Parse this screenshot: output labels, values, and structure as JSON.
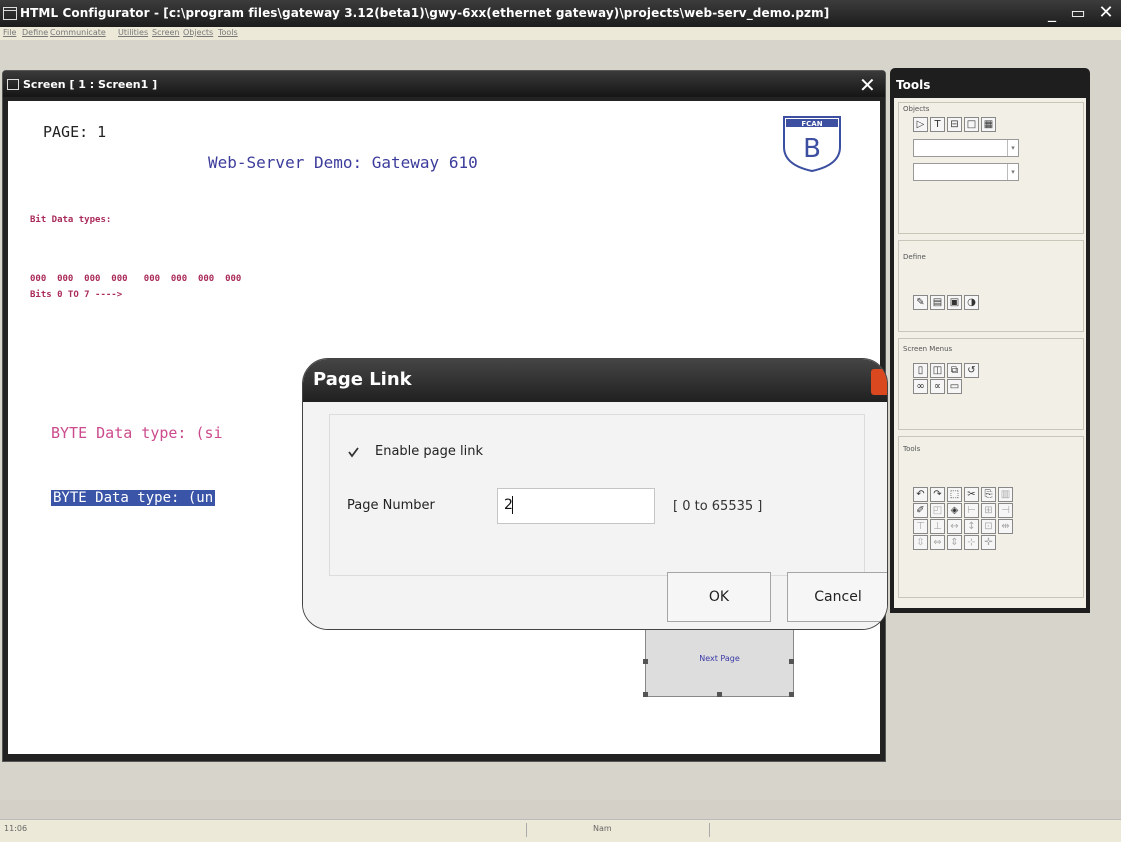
{
  "app": {
    "title": "HTML Configurator - [c:\\program files\\gateway 3.12(beta1)\\gwy-6xx(ethernet gateway)\\projects\\web-serv_demo.pzm]",
    "min_glyph": "_",
    "max_glyph": "▭",
    "close_glyph": "✕"
  },
  "menu": [
    "File",
    "Define",
    "Communicate",
    "Utilities",
    "Screen",
    "Objects",
    "Tools"
  ],
  "screen_window": {
    "title": "Screen [ 1 : Screen1 ]",
    "close_glyph": "✕",
    "page_label": "PAGE: 1",
    "heading": "Web-Server Demo: Gateway 610",
    "bit_types_label": "Bit Data types:",
    "bit_values": "000  000  000  000   000  000  000  000",
    "bits_range_label": "Bits 0 TO 7 ---->",
    "byte_signed_label": "BYTE Data type: (si",
    "byte_unsigned_label": "BYTE Data type: (un",
    "logo_label": "B",
    "logo_top": "FCAN",
    "next_page_button": "Next Page"
  },
  "tools_panel": {
    "title": "Tools",
    "objects_label": "Objects",
    "define_label": "Define",
    "screen_menus_label": "Screen Menus",
    "tools_label": "Tools"
  },
  "dialog": {
    "title": "Page Link",
    "enable_label": "Enable page link",
    "enable_checked": true,
    "page_number_label": "Page Number",
    "page_number_value": "2",
    "range_hint": "[ 0 to 65535 ]",
    "ok_label": "OK",
    "cancel_label": "Cancel"
  },
  "status": {
    "left": "11:06",
    "mid": "Nam"
  }
}
